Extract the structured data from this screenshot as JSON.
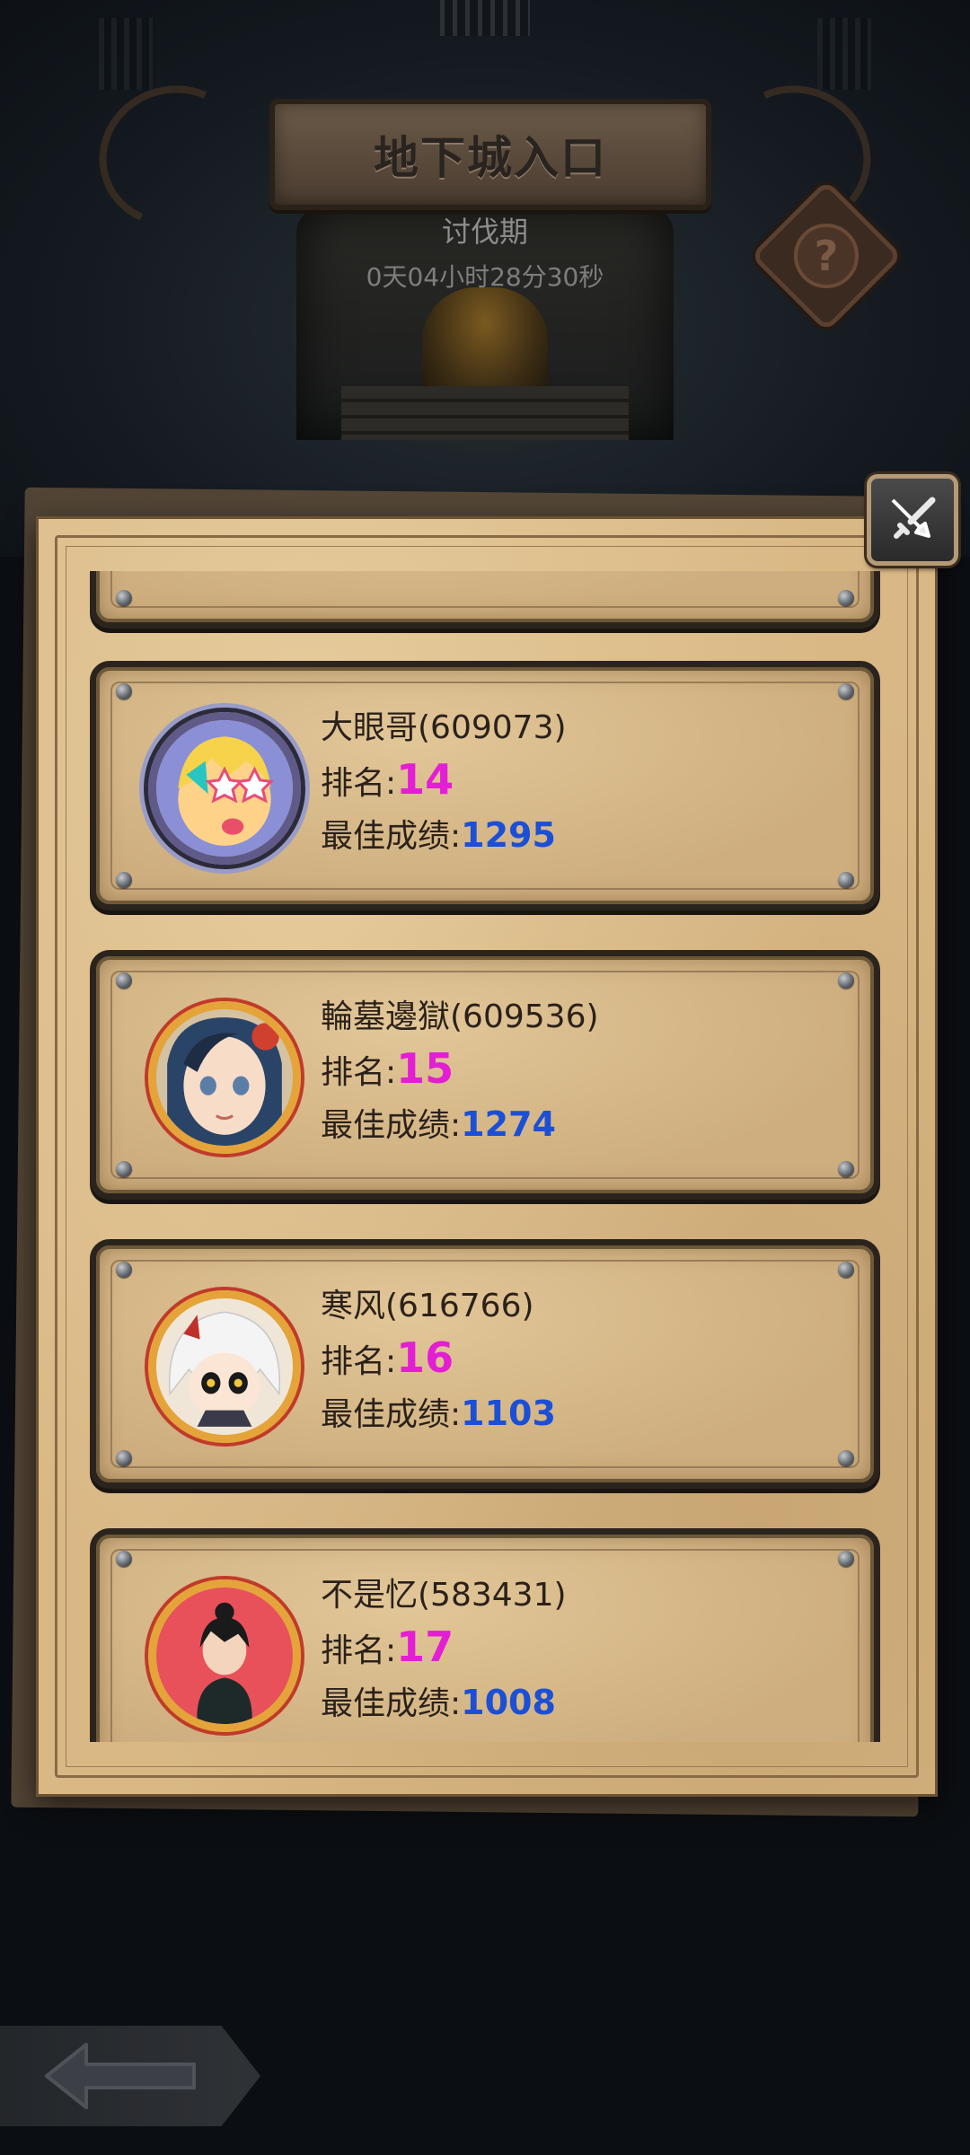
{
  "header": {
    "title": "地下城入口",
    "phase": "讨伐期",
    "countdown": "0天04小时28分30秒"
  },
  "labels": {
    "rank": "排名:",
    "best_score": "最佳成绩:"
  },
  "leaderboard": [
    {
      "name": "大眼哥(609073)",
      "rank": "14",
      "best_score": "1295",
      "avatar_icon": "girl-star-glasses-avatar",
      "frame": "silver"
    },
    {
      "name": "輪墓邊獄(609536)",
      "rank": "15",
      "best_score": "1274",
      "avatar_icon": "girl-avatar",
      "frame": "gold"
    },
    {
      "name": "寒风(616766)",
      "rank": "16",
      "best_score": "1103",
      "avatar_icon": "white-hair-boy-avatar",
      "frame": "gold"
    },
    {
      "name": "不是忆(583431)",
      "rank": "17",
      "best_score": "1008",
      "avatar_icon": "dark-hair-man-avatar",
      "frame": "gold"
    }
  ],
  "colors": {
    "rank_color": "#e31ed4",
    "score_color": "#1b4fd6",
    "parchment": "#d9b885"
  },
  "icons": {
    "help": "question-mark-icon",
    "close": "crossed-swords-icon",
    "back": "back-arrow-icon"
  },
  "help_glyph": "?"
}
